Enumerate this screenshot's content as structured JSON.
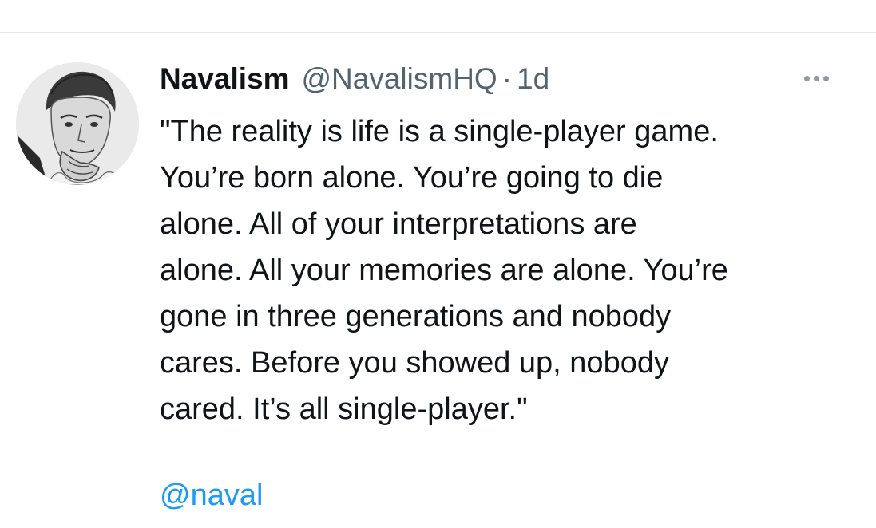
{
  "tweet": {
    "author": {
      "display_name": "Navalism",
      "handle": "@NavalismHQ"
    },
    "separator": "·",
    "time": "1d",
    "more_icon": "more-horizontal-icon",
    "text": "\"The reality is life is a single-player game.\nYou’re born alone. You’re going to die\nalone. All of your interpretations are\nalone. All your memories are alone. You’re\ngone in three generations and nobody\ncares. Before you showed up, nobody\ncared. It’s all single-player.\"",
    "mention": "@naval"
  },
  "colors": {
    "text": "#0f1419",
    "secondary": "#536471",
    "link": "#1d9bf0",
    "divider": "#e3e7ea"
  }
}
